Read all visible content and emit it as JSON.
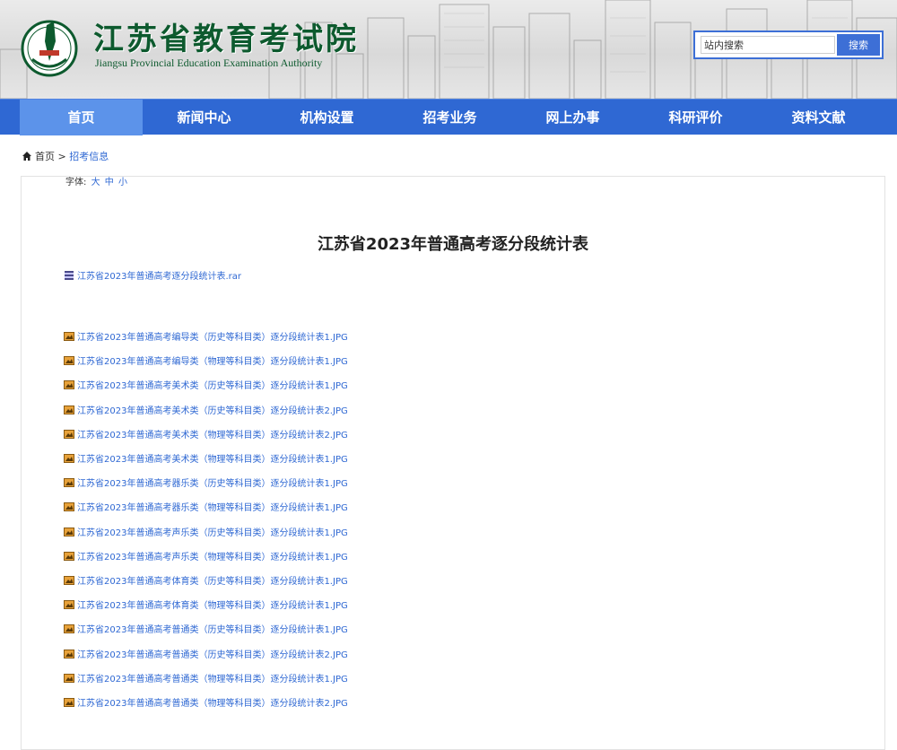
{
  "header": {
    "logo_cn": "江苏省教育考试院",
    "logo_en": "Jiangsu Provincial Education Examination Authority",
    "search": {
      "placeholder": "站内搜索",
      "value": "站内搜索",
      "button_label": "搜索"
    },
    "accent_color": "#2f68d3"
  },
  "nav": {
    "items": [
      {
        "label": "首页",
        "active": true
      },
      {
        "label": "新闻中心"
      },
      {
        "label": "机构设置"
      },
      {
        "label": "招考业务"
      },
      {
        "label": "网上办事"
      },
      {
        "label": "科研评价"
      },
      {
        "label": "资料文献"
      }
    ]
  },
  "breadcrumb": {
    "home": "首页",
    "separator": ">",
    "current": "招考信息"
  },
  "article": {
    "font_label": "字体:",
    "font_options": [
      "大",
      "中",
      "小"
    ],
    "title": "江苏省2023年普通高考逐分段统计表",
    "archive": {
      "name": "江苏省2023年普通高考逐分段统计表.rar",
      "icon": "archive-icon"
    },
    "images": [
      "江苏省2023年普通高考编导类（历史等科目类）逐分段统计表1.JPG",
      "江苏省2023年普通高考编导类（物理等科目类）逐分段统计表1.JPG",
      "江苏省2023年普通高考美术类（历史等科目类）逐分段统计表1.JPG",
      "江苏省2023年普通高考美术类（历史等科目类）逐分段统计表2.JPG",
      "江苏省2023年普通高考美术类（物理等科目类）逐分段统计表2.JPG",
      "江苏省2023年普通高考美术类（物理等科目类）逐分段统计表1.JPG",
      "江苏省2023年普通高考器乐类（历史等科目类）逐分段统计表1.JPG",
      "江苏省2023年普通高考器乐类（物理等科目类）逐分段统计表1.JPG",
      "江苏省2023年普通高考声乐类（历史等科目类）逐分段统计表1.JPG",
      "江苏省2023年普通高考声乐类（物理等科目类）逐分段统计表1.JPG",
      "江苏省2023年普通高考体育类（历史等科目类）逐分段统计表1.JPG",
      "江苏省2023年普通高考体育类（物理等科目类）逐分段统计表1.JPG",
      "江苏省2023年普通高考普通类（历史等科目类）逐分段统计表1.JPG",
      "江苏省2023年普通高考普通类（历史等科目类）逐分段统计表2.JPG",
      "江苏省2023年普通高考普通类（物理等科目类）逐分段统计表1.JPG",
      "江苏省2023年普通高考普通类（物理等科目类）逐分段统计表2.JPG"
    ]
  }
}
